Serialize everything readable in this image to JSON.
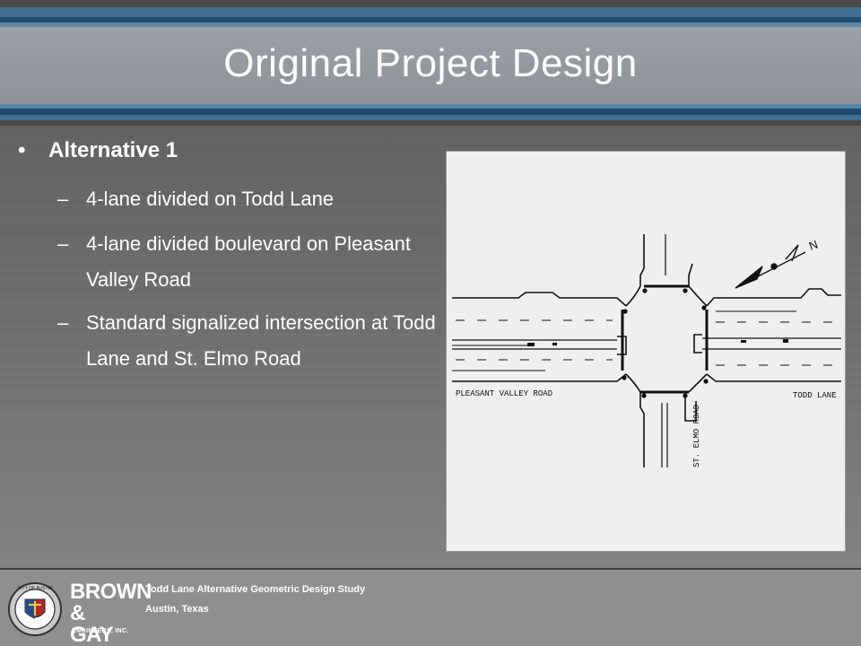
{
  "slide": {
    "title": "Original Project Design"
  },
  "bullets": {
    "main": "Alternative 1",
    "subs": [
      "4-lane divided on Todd Lane",
      "4-lane divided boulevard on Pleasant Valley Road",
      "Standard signalized intersection at Todd Lane and St. Elmo Road"
    ],
    "dash": "–",
    "dot": "•"
  },
  "drawing": {
    "label_pleasant_valley": "PLEASANT VALLEY ROAD",
    "label_todd": "TODD LANE",
    "label_st_elmo": "ST. ELMO ROAD",
    "north_symbol": "N"
  },
  "footer": {
    "project": "Todd Lane Alternative Geometric Design Study",
    "location": "Austin, Texas",
    "logo_line1": "BROWN",
    "logo_line2": "& GAY",
    "logo_line3": "ENGINEERS, INC.",
    "seal_text": "CITY OF AUSTIN"
  },
  "colors": {
    "title_band": "#8d9399",
    "stripe_blue": "#3f6e90",
    "stripe_dark_blue": "#1f4a6b",
    "background": "#6a6a6a",
    "drawing_background": "#efefef"
  }
}
